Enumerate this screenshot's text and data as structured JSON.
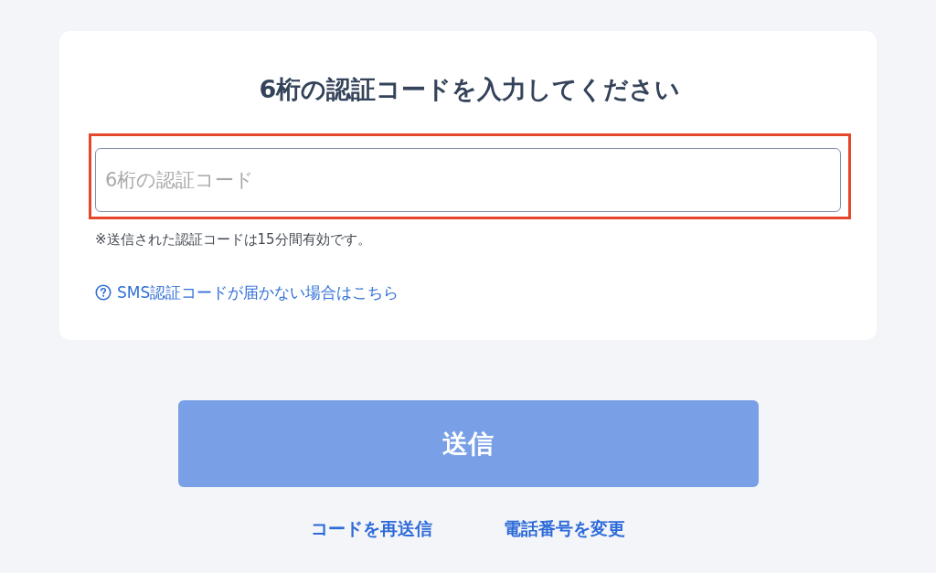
{
  "card": {
    "title": "6桁の認証コードを入力してください",
    "code_input": {
      "placeholder": "6桁の認証コード",
      "highlighted": true
    },
    "note": "※送信された認証コードは15分間有効です。",
    "help_link": "SMS認証コードが届かない場合はこちら"
  },
  "submit_button": {
    "label": "送信",
    "disabled": true
  },
  "footer_links": [
    "コードを再送信",
    "電話番号を変更"
  ]
}
